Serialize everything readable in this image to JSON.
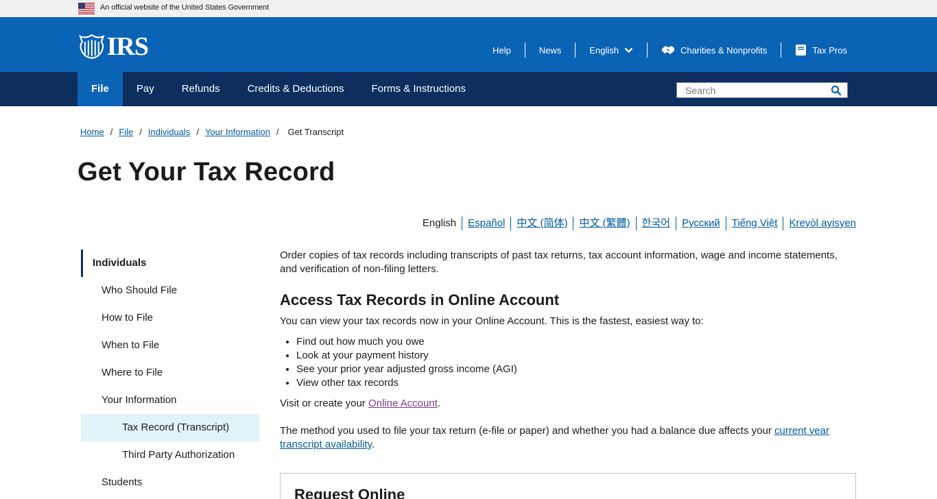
{
  "gov_banner": {
    "text": "An official website of the United States Government",
    "flag_icon": "us-flag-icon"
  },
  "header": {
    "logo_text": "IRS",
    "logo_icon": "irs-eagle-icon",
    "util_nav": {
      "help": "Help",
      "news": "News",
      "language": "English",
      "charities": "Charities & Nonprofits",
      "tax_pros": "Tax Pros"
    }
  },
  "main_nav": {
    "items": [
      "File",
      "Pay",
      "Refunds",
      "Credits & Deductions",
      "Forms & Instructions"
    ],
    "active": "File",
    "search_placeholder": "Search"
  },
  "breadcrumb": {
    "items": [
      "Home",
      "File",
      "Individuals",
      "Your Information"
    ],
    "current": "Get Transcript",
    "separator": "/"
  },
  "page": {
    "title": "Get Your Tax Record"
  },
  "languages": {
    "current": "English",
    "links": [
      "Español",
      "中文 (简体)",
      "中文 (繁體)",
      "한국어",
      "Русский",
      "Tiếng Việt",
      "Kreyòl ayisyen"
    ]
  },
  "sidebar": {
    "heading": "Individuals",
    "items": [
      "Who Should File",
      "How to File",
      "When to File",
      "Where to File",
      "Your Information"
    ],
    "sub_items": [
      "Tax Record (Transcript)",
      "Third Party Authorization"
    ],
    "after": "Students",
    "active": "Tax Record (Transcript)"
  },
  "content": {
    "intro": "Order copies of tax records including transcripts of past tax returns, tax account information, wage and income statements, and verification of non-filing letters.",
    "section_heading": "Access Tax Records in Online Account",
    "section_lead": "You can view your tax records now in your Online Account. This is the fastest, easiest way to:",
    "bullets": [
      "Find out how much you owe",
      "Look at your payment history",
      "See your prior year adjusted gross income (AGI)",
      "View other tax records"
    ],
    "visit_prefix": "Visit or create your ",
    "visit_link": "Online Account",
    "visit_suffix": ".",
    "method_text": "The method you used to file your tax return (e-file or paper) and whether you had a balance due affects  your ",
    "method_link": "current year transcript availability",
    "method_suffix": ".",
    "request_heading": "Request Online"
  },
  "colors": {
    "header_blue": "#0b63b5",
    "nav_navy": "#0c2f5e",
    "link": "#00599c",
    "visited_link": "#7a3d8a",
    "active_sidebar_bg": "#e1f3f8"
  }
}
